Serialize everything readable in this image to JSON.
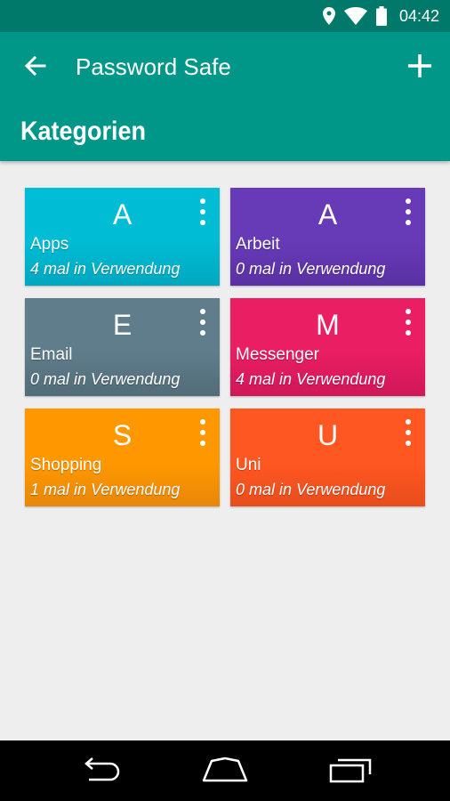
{
  "status_bar": {
    "time": "04:42",
    "icons": [
      "location-icon",
      "wifi-icon",
      "battery-icon"
    ],
    "background": "#00796b"
  },
  "app_bar": {
    "title": "Password Safe",
    "section_title": "Kategorien",
    "background": "#009688",
    "icons": [
      "back-arrow-icon",
      "add-icon"
    ]
  },
  "categories": [
    {
      "letter": "A",
      "name": "Apps",
      "usage": "4 mal in Verwendung",
      "color": "#00bcd4",
      "color_dark": "#00a7bf"
    },
    {
      "letter": "A",
      "name": "Arbeit",
      "usage": "0 mal in Verwendung",
      "color": "#673ab7",
      "color_dark": "#5a31a3"
    },
    {
      "letter": "E",
      "name": "Email",
      "usage": "0 mal in Verwendung",
      "color": "#607d8b",
      "color_dark": "#526c78"
    },
    {
      "letter": "M",
      "name": "Messenger",
      "usage": "4 mal in Verwendung",
      "color": "#e91e63",
      "color_dark": "#d01757"
    },
    {
      "letter": "S",
      "name": "Shopping",
      "usage": "1 mal in Verwendung",
      "color": "#ff9800",
      "color_dark": "#e8870a"
    },
    {
      "letter": "U",
      "name": "Uni",
      "usage": "0 mal in Verwendung",
      "color": "#ff5722",
      "color_dark": "#e84d1c"
    }
  ],
  "nav_bar": {
    "icons": [
      "back-icon",
      "home-icon",
      "recent-apps-icon"
    ]
  }
}
